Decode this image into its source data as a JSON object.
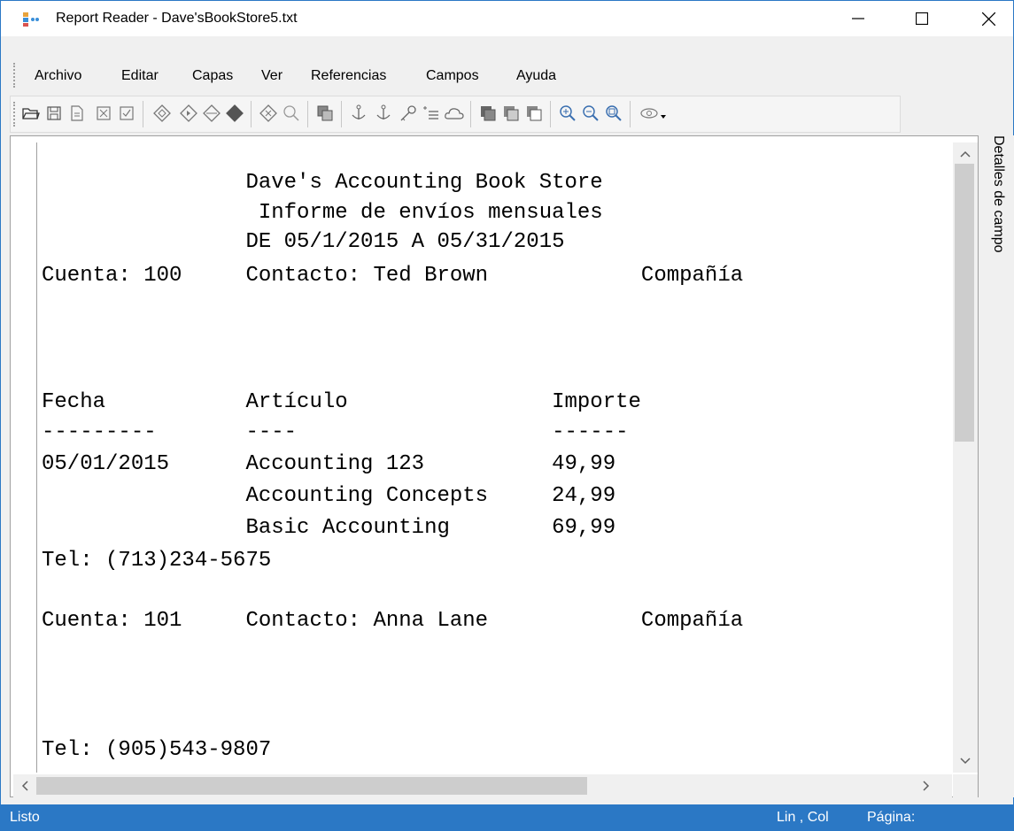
{
  "window": {
    "title": "Report Reader - Dave'sBookStore5.txt",
    "accent_color": "#2b78c5"
  },
  "menu": {
    "items": [
      "Archivo",
      "Editar",
      "Capas",
      "Ver",
      "Referencias",
      "Campos",
      "Ayuda"
    ]
  },
  "toolbar": {
    "icons": [
      "open-folder-icon",
      "save-icon",
      "export-icon",
      "close-file-icon",
      "check-file-icon",
      "layer-add-icon",
      "layer-next-icon",
      "layer-prev-icon",
      "layer-down-icon",
      "clear-layer-icon",
      "zoom-find-icon",
      "copy-field-icon",
      "anchor-icon",
      "anchor-2-icon",
      "key-icon",
      "list-add-icon",
      "cloud-icon",
      "stack-1-icon",
      "stack-2-icon",
      "stack-3-icon",
      "zoom-in-icon",
      "zoom-out-icon",
      "zoom-fit-icon",
      "eye-icon"
    ]
  },
  "document": {
    "lines": [
      "                Dave's Accounting Book Store",
      "                 Informe de envíos mensuales",
      "                DE 05/1/2015 A 05/31/2015",
      "Cuenta: 100     Contacto: Ted Brown            Compañía",
      "",
      "",
      "",
      "Fecha           Artículo                Importe",
      "---------       ----                    ------",
      "05/01/2015      Accounting 123          49,99",
      "                Accounting Concepts     24,99",
      "                Basic Accounting        69,99",
      "Tel: (713)234-5675",
      "",
      "Cuenta: 101     Contacto: Anna Lane            Compañía",
      "",
      "",
      "",
      "Tel: (905)543-9807"
    ]
  },
  "side_panel": {
    "label": "Detalles de campo"
  },
  "status": {
    "text": "Listo",
    "lincol": "Lin , Col",
    "page": "Página:"
  }
}
